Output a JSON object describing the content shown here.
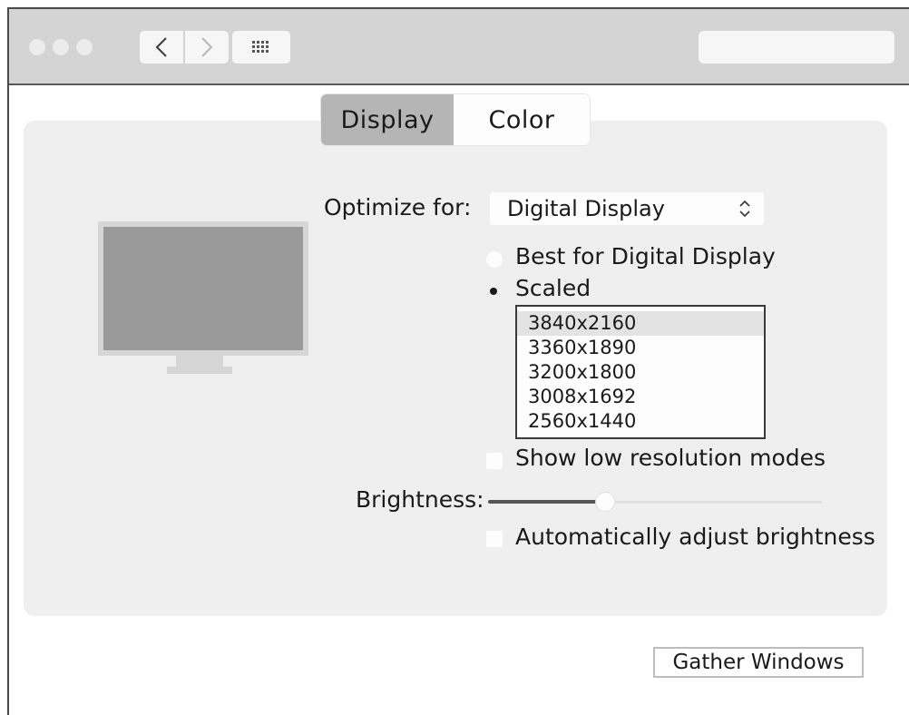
{
  "window": {
    "tabs": [
      {
        "label": "Display",
        "selected": true
      },
      {
        "label": "Color",
        "selected": false
      }
    ]
  },
  "toolbar": {
    "icons": [
      "window-close-dot",
      "window-minimize-dot",
      "window-zoom-dot",
      "back-chevron",
      "forward-chevron",
      "grid-icon",
      "search-field"
    ]
  },
  "display": {
    "optimize_label": "Optimize for:",
    "optimize_value": "Digital Display",
    "radio_best": {
      "label": "Best for Digital Display",
      "selected": false
    },
    "radio_scaled": {
      "label": "Scaled",
      "selected": true
    },
    "resolutions": [
      "3840x2160",
      "3360x1890",
      "3200x1800",
      "3008x1692",
      "2560x1440"
    ],
    "selected_resolution": "3840x2160",
    "show_low_res": {
      "label": "Show low resolution modes",
      "checked": false
    },
    "brightness_label": "Brightness:",
    "brightness_level": 0.35,
    "auto_brightness": {
      "label": "Automatically adjust brightness",
      "checked": false
    }
  },
  "footer": {
    "gather_label": "Gather Windows"
  }
}
